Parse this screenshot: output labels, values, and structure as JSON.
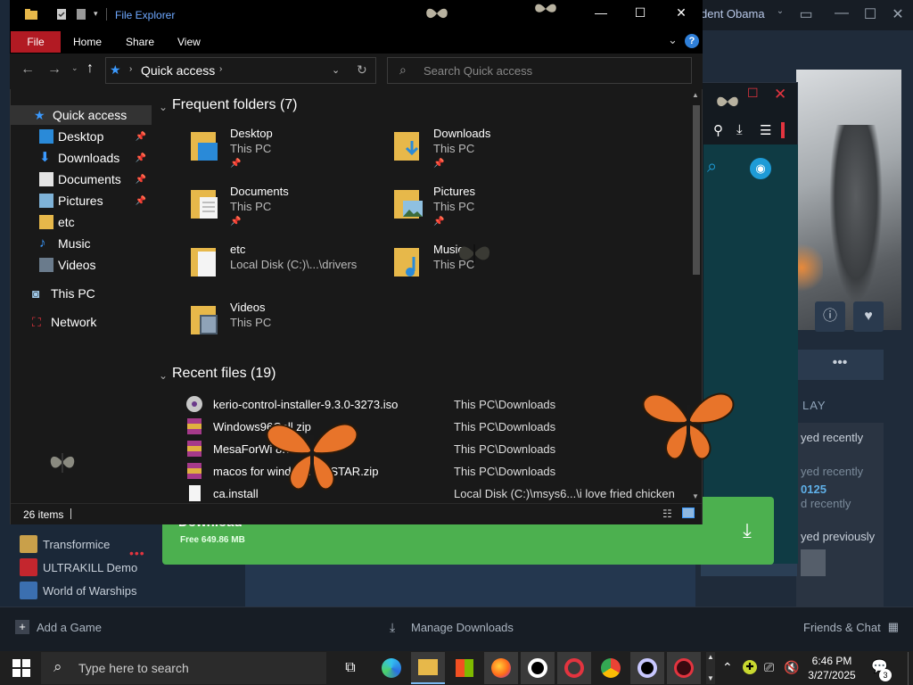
{
  "steam": {
    "user_name": "dent Obama",
    "games": [
      {
        "label": "Transformice",
        "color": "#c9a04a"
      },
      {
        "label": "ULTRAKILL Demo",
        "color": "#c4262e"
      },
      {
        "label": "World of Warships",
        "color": "#3b6fb0"
      }
    ],
    "play_heading": "LAY",
    "play_rows": [
      "yed recently",
      "yed recently",
      "0125",
      "d recently",
      "yed previously"
    ],
    "download_title": "Download",
    "download_sub": "Free    649.86 MB",
    "footer": {
      "add_game": "Add a Game",
      "manage_downloads": "Manage Downloads",
      "friends_chat": "Friends & Chat"
    },
    "accent": "#4cb04f"
  },
  "explorer": {
    "title": "File Explorer",
    "ribbon_tabs": {
      "file": "File",
      "home": "Home",
      "share": "Share",
      "view": "View"
    },
    "address": "Quick access",
    "search_placeholder": "Search Quick access",
    "nav": {
      "quick_access": "Quick access",
      "items": [
        "Desktop",
        "Downloads",
        "Documents",
        "Pictures",
        "etc",
        "Music",
        "Videos"
      ],
      "this_pc": "This PC",
      "network": "Network"
    },
    "frequent_heading": "Frequent folders (7)",
    "folders": [
      {
        "name": "Desktop",
        "sub": "This PC"
      },
      {
        "name": "Downloads",
        "sub": "This PC"
      },
      {
        "name": "Documents",
        "sub": "This PC"
      },
      {
        "name": "Pictures",
        "sub": "This PC"
      },
      {
        "name": "etc",
        "sub": "Local Disk (C:)\\...\\drivers"
      },
      {
        "name": "Music",
        "sub": "This PC"
      },
      {
        "name": "Videos",
        "sub": "This PC"
      }
    ],
    "recent_heading": "Recent files (19)",
    "recent": [
      {
        "name": "kerio-control-installer-9.3.0-3273.iso",
        "loc": "This PC\\Downloads"
      },
      {
        "name": "Windows96Coll         zip",
        "loc": "This PC\\Downloads"
      },
      {
        "name": "MesaForWi           8.7z",
        "loc": "This PC\\Downloads"
      },
      {
        "name": "macos for windows by      STAR.zip",
        "loc": "This PC\\Downloads"
      },
      {
        "name": "ca.install",
        "loc": "Local Disk (C:)\\msys6...\\i love fried chicken"
      }
    ],
    "status": "26 items"
  },
  "taskbar": {
    "search_placeholder": "Type here to search",
    "time": "6:46 PM",
    "date": "3/27/2025",
    "notif_count": "3"
  }
}
